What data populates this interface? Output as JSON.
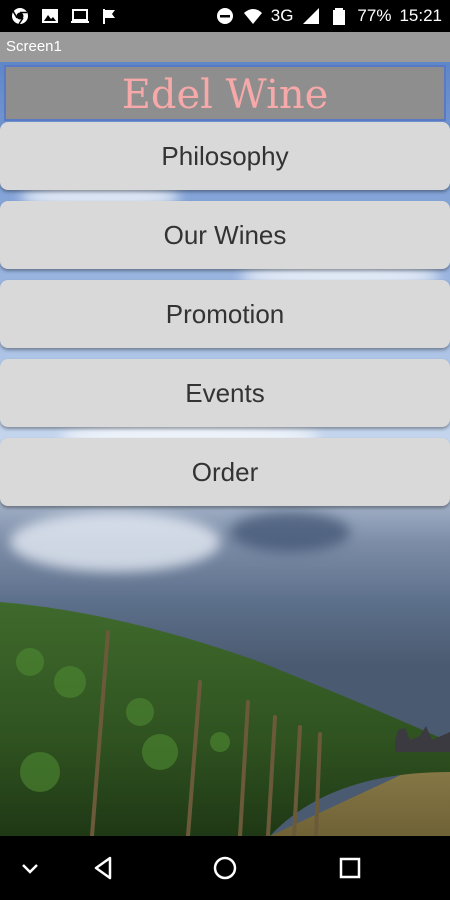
{
  "status_bar": {
    "network": "3G",
    "battery": "77%",
    "time": "15:21",
    "left_icons": [
      "chrome-icon",
      "image-icon",
      "laptop-icon",
      "flag-icon"
    ],
    "right_icons": [
      "do-not-disturb-icon",
      "wifi-icon",
      "signal-icon",
      "battery-icon"
    ]
  },
  "app": {
    "screen_title": "Screen1",
    "header_title": "Edel Wine",
    "header_color": "#f7a8a8"
  },
  "menu": {
    "items": [
      {
        "label": "Philosophy"
      },
      {
        "label": "Our Wines"
      },
      {
        "label": "Promotion"
      },
      {
        "label": "Events"
      },
      {
        "label": "Order"
      }
    ]
  },
  "nav_bar": {
    "icons": [
      "chevron-down-icon",
      "back-icon",
      "home-icon",
      "recents-icon"
    ]
  }
}
